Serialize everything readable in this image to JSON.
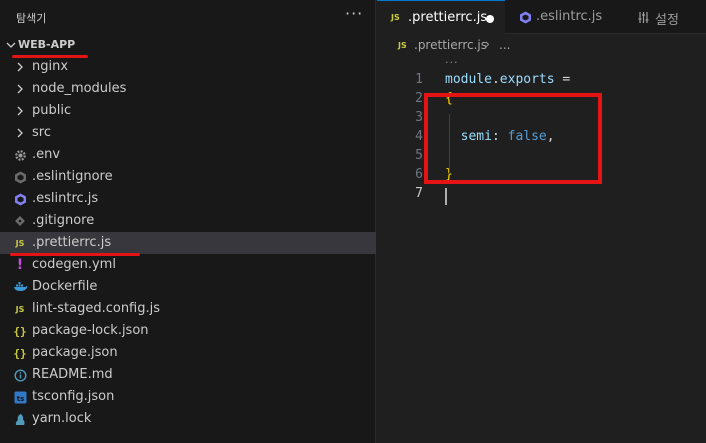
{
  "explorer": {
    "title": "탐색기",
    "more_glyph": "···",
    "root_folder": "WEB-APP",
    "items": [
      {
        "label": "nginx",
        "type": "folder",
        "icon": "chevron-right-icon"
      },
      {
        "label": "node_modules",
        "type": "folder",
        "icon": "chevron-right-icon"
      },
      {
        "label": "public",
        "type": "folder",
        "icon": "chevron-right-icon"
      },
      {
        "label": "src",
        "type": "folder",
        "icon": "chevron-right-icon"
      },
      {
        "label": ".env",
        "type": "file",
        "icon": "gear-icon"
      },
      {
        "label": ".eslintignore",
        "type": "file",
        "icon": "eslint-icon"
      },
      {
        "label": ".eslintrc.js",
        "type": "file",
        "icon": "eslint-icon"
      },
      {
        "label": ".gitignore",
        "type": "file",
        "icon": "git-icon"
      },
      {
        "label": ".prettierrc.js",
        "type": "file",
        "icon": "js-icon",
        "icon_text": "JS",
        "selected": true
      },
      {
        "label": "codegen.yml",
        "type": "file",
        "icon": "yaml-icon",
        "icon_text": "!"
      },
      {
        "label": "Dockerfile",
        "type": "file",
        "icon": "docker-icon"
      },
      {
        "label": "lint-staged.config.js",
        "type": "file",
        "icon": "js-icon",
        "icon_text": "JS"
      },
      {
        "label": "package-lock.json",
        "type": "file",
        "icon": "json-icon",
        "icon_text": "{}"
      },
      {
        "label": "package.json",
        "type": "file",
        "icon": "json-icon",
        "icon_text": "{}"
      },
      {
        "label": "README.md",
        "type": "file",
        "icon": "info-icon"
      },
      {
        "label": "tsconfig.json",
        "type": "file",
        "icon": "typescript-icon"
      },
      {
        "label": "yarn.lock",
        "type": "file",
        "icon": "yarn-icon"
      }
    ]
  },
  "tabs": [
    {
      "label": ".prettierrc.js",
      "icon_text": "JS",
      "active": true,
      "modified": true
    },
    {
      "label": ".eslintrc.js",
      "active": false
    },
    {
      "label": "설정",
      "active": false
    }
  ],
  "breadcrumb": {
    "file": ".prettierrc.js",
    "separator": "›",
    "more": "..."
  },
  "editor": {
    "hint": "···",
    "current_line": 7,
    "lines": [
      {
        "no": "1",
        "tokens": [
          {
            "t": "module",
            "c": "var"
          },
          {
            "t": ".",
            "c": "plain"
          },
          {
            "t": "exports",
            "c": "var"
          },
          {
            "t": " =",
            "c": "plain"
          }
        ]
      },
      {
        "no": "2",
        "tokens": [
          {
            "t": "{",
            "c": "brace"
          }
        ]
      },
      {
        "no": "3",
        "tokens": []
      },
      {
        "no": "4",
        "tokens": [
          {
            "t": "  semi",
            "c": "prop"
          },
          {
            "t": ": ",
            "c": "plain"
          },
          {
            "t": "false",
            "c": "bool"
          },
          {
            "t": ",",
            "c": "plain"
          }
        ]
      },
      {
        "no": "5",
        "tokens": []
      },
      {
        "no": "6",
        "tokens": [
          {
            "t": "}",
            "c": "brace"
          }
        ]
      },
      {
        "no": "7",
        "tokens": []
      }
    ]
  },
  "colors": {
    "accent": "#0078d4",
    "annotation_red": "#e51414",
    "js_yellow": "#cbcb41"
  }
}
